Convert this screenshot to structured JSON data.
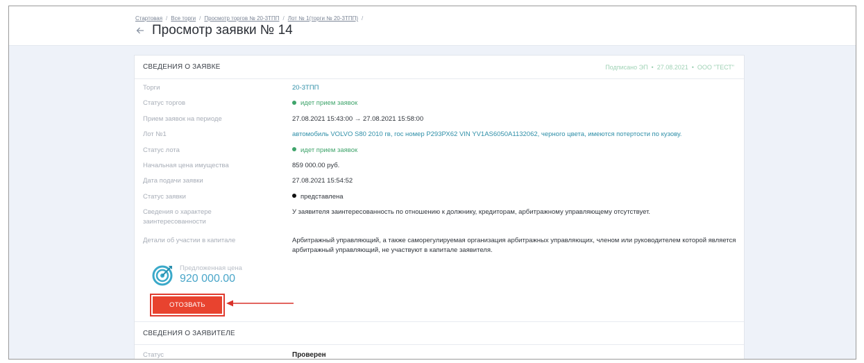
{
  "breadcrumb": [
    {
      "label": "Стартовая"
    },
    {
      "label": "Все торги"
    },
    {
      "label": "Просмотр торгов № 20-3ТПП"
    },
    {
      "label": "Лот № 1(торги № 20-3ТПП)"
    }
  ],
  "breadcrumb_separator": "/",
  "page_title": "Просмотр заявки № 14",
  "application_section": {
    "title": "СВЕДЕНИЯ О ЗАЯВКЕ",
    "signed": {
      "status": "Подписано ЭП",
      "date": "27.08.2021",
      "org": "ООО \"ТЕСТ\"",
      "color": "#9fd2b5"
    },
    "rows": [
      {
        "label": "Торги",
        "value": "20-3ТПП",
        "style": "link"
      },
      {
        "label": "Статус торгов",
        "value": "идет прием заявок",
        "style": "green",
        "dot_color": "#3fa46b"
      },
      {
        "label": "Прием заявок на периоде",
        "value": "27.08.2021 15:43:00 → 27.08.2021 15:58:00",
        "style": "plain"
      },
      {
        "label": "Лот №1",
        "value": "автомобиль VOLVO S80 2010 гв, гос номер Р293РХ62 VIN YV1AS6050A1132062, черного цвета, имеются потертости по кузову.",
        "style": "link"
      },
      {
        "label": "Статус лота",
        "value": "идет прием заявок",
        "style": "green",
        "dot_color": "#3fa46b"
      },
      {
        "label": "Начальная цена имущества",
        "value": "859 000.00 руб.",
        "style": "plain"
      },
      {
        "label": "Дата подачи заявки",
        "value": "27.08.2021 15:54:52",
        "style": "plain"
      },
      {
        "label": "Статус заявки",
        "value": "представлена",
        "style": "plain",
        "dot_color": "#111111"
      },
      {
        "label": "Сведения о характере заинтересованности",
        "value": "У заявителя заинтересованность по отношению к должнику, кредиторам, арбитражному управляющему отсутствует.",
        "style": "plain"
      },
      {
        "label": "Детали об участии в капитале",
        "value": "Арбитражный управляющий, а также саморегулируемая организация арбитражных управляющих, членом или руководителем которой является арбитражный управляющий, не участвуют в капитале заявителя.",
        "style": "plain"
      }
    ],
    "offered_price": {
      "label": "Предложенная цена",
      "value": "920 000.00"
    },
    "withdraw_button": "ОТОЗВАТЬ"
  },
  "applicant_section": {
    "title": "СВЕДЕНИЯ О ЗАЯВИТЕЛЕ",
    "rows": [
      {
        "label": "Статус",
        "value": "Проверен"
      }
    ]
  },
  "icons": {
    "back": "arrow-left-icon",
    "target": "target-icon",
    "annotation_arrow": "red-arrow-annotation"
  },
  "colors": {
    "accent": "#2f8fa8",
    "status_green": "#3fa46b",
    "danger": "#e8432f",
    "price": "#4aa6c9"
  }
}
